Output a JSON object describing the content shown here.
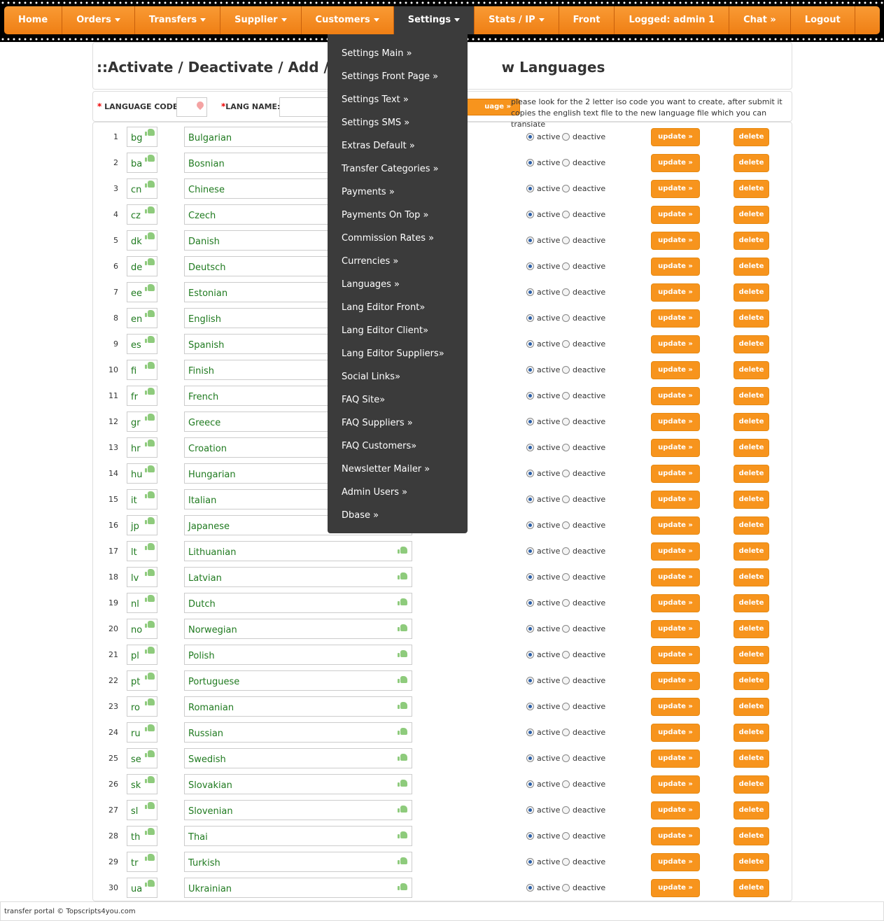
{
  "nav": {
    "items": [
      {
        "label": "Home",
        "caret": false
      },
      {
        "label": "Orders",
        "caret": true
      },
      {
        "label": "Transfers",
        "caret": true
      },
      {
        "label": "Supplier",
        "caret": true
      },
      {
        "label": "Customers",
        "caret": true
      },
      {
        "label": "Settings",
        "caret": true,
        "active": true
      },
      {
        "label": "Stats / IP",
        "caret": true
      },
      {
        "label": "Front",
        "caret": false
      },
      {
        "label": "Logged: admin 1",
        "caret": false
      },
      {
        "label": "Chat »",
        "caret": false
      },
      {
        "label": "Logout",
        "caret": false
      }
    ]
  },
  "page": {
    "title_left": "::Activate / Deactivate / Add / Edi",
    "title_right": "w Languages"
  },
  "add_form": {
    "code_label": "LANGUAGE CODE:",
    "name_label": "LANG NAME:",
    "required_mark": "*",
    "button_label": "uage »",
    "note": "please look for the 2 letter iso code you want to create, after submit it copies the english text file to the new language file which you can translate"
  },
  "row_labels": {
    "active": "active",
    "deactive": "deactive",
    "update": "update »",
    "delete": "delete"
  },
  "languages": [
    {
      "num": "1",
      "code": "bg",
      "name": "Bulgarian"
    },
    {
      "num": "2",
      "code": "ba",
      "name": "Bosnian"
    },
    {
      "num": "3",
      "code": "cn",
      "name": "Chinese"
    },
    {
      "num": "4",
      "code": "cz",
      "name": "Czech"
    },
    {
      "num": "5",
      "code": "dk",
      "name": "Danish"
    },
    {
      "num": "6",
      "code": "de",
      "name": "Deutsch"
    },
    {
      "num": "7",
      "code": "ee",
      "name": "Estonian"
    },
    {
      "num": "8",
      "code": "en",
      "name": "English"
    },
    {
      "num": "9",
      "code": "es",
      "name": "Spanish"
    },
    {
      "num": "10",
      "code": "fi",
      "name": "Finish"
    },
    {
      "num": "11",
      "code": "fr",
      "name": "French"
    },
    {
      "num": "12",
      "code": "gr",
      "name": "Greece"
    },
    {
      "num": "13",
      "code": "hr",
      "name": "Croation"
    },
    {
      "num": "14",
      "code": "hu",
      "name": "Hungarian"
    },
    {
      "num": "15",
      "code": "it",
      "name": "Italian"
    },
    {
      "num": "16",
      "code": "jp",
      "name": "Japanese"
    },
    {
      "num": "17",
      "code": "lt",
      "name": "Lithuanian"
    },
    {
      "num": "18",
      "code": "lv",
      "name": "Latvian"
    },
    {
      "num": "19",
      "code": "nl",
      "name": "Dutch"
    },
    {
      "num": "20",
      "code": "no",
      "name": "Norwegian"
    },
    {
      "num": "21",
      "code": "pl",
      "name": "Polish"
    },
    {
      "num": "22",
      "code": "pt",
      "name": "Portuguese"
    },
    {
      "num": "23",
      "code": "ro",
      "name": "Romanian"
    },
    {
      "num": "24",
      "code": "ru",
      "name": "Russian"
    },
    {
      "num": "25",
      "code": "se",
      "name": "Swedish"
    },
    {
      "num": "26",
      "code": "sk",
      "name": "Slovakian"
    },
    {
      "num": "27",
      "code": "sl",
      "name": "Slovenian"
    },
    {
      "num": "28",
      "code": "th",
      "name": "Thai"
    },
    {
      "num": "29",
      "code": "tr",
      "name": "Turkish"
    },
    {
      "num": "30",
      "code": "ua",
      "name": "Ukrainian"
    }
  ],
  "settings_menu": [
    "Settings Main »",
    "Settings Front Page »",
    "Settings Text »",
    "Settings SMS »",
    "Extras Default »",
    "Transfer Categories »",
    "Payments »",
    "Payments On Top »",
    "Commission Rates »",
    "Currencies »",
    "Languages »",
    "Lang Editor Front»",
    "Lang Editor Client»",
    "Lang Editor Suppliers»",
    "Social Links»",
    "FAQ Site»",
    "FAQ Suppliers »",
    "FAQ Customers»",
    "Newsletter Mailer »",
    "Admin Users »",
    "Dbase »"
  ],
  "footer": {
    "text": "transfer portal © Topscripts4you.com"
  },
  "colors": {
    "accent": "#f7941d",
    "menu_bg": "#3b3b3b",
    "code_text": "#1f7a1f"
  }
}
